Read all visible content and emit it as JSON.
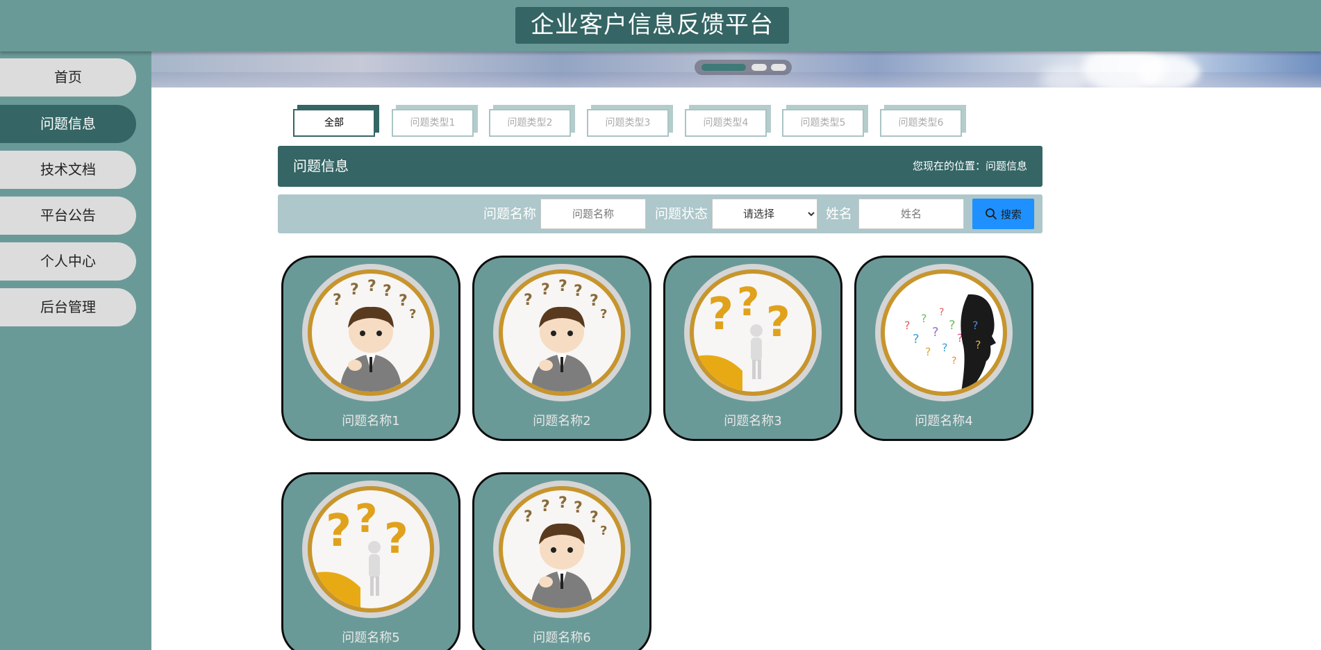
{
  "header": {
    "site_title": "企业客户信息反馈平台"
  },
  "sidebar": {
    "items": [
      {
        "label": "首页"
      },
      {
        "label": "问题信息"
      },
      {
        "label": "技术文档"
      },
      {
        "label": "平台公告"
      },
      {
        "label": "个人中心"
      },
      {
        "label": "后台管理"
      }
    ],
    "active_index": 1
  },
  "tabs": [
    {
      "label": "全部"
    },
    {
      "label": "问题类型1"
    },
    {
      "label": "问题类型2"
    },
    {
      "label": "问题类型3"
    },
    {
      "label": "问题类型4"
    },
    {
      "label": "问题类型5"
    },
    {
      "label": "问题类型6"
    }
  ],
  "section": {
    "title": "问题信息",
    "breadcrumb": "您现在的位置：问题信息"
  },
  "search": {
    "name_label": "问题名称",
    "name_placeholder": "问题名称",
    "status_label": "问题状态",
    "status_selected": "请选择",
    "person_label": "姓名",
    "person_placeholder": "姓名",
    "button_label": "搜索"
  },
  "cards": [
    {
      "name": "问题名称1",
      "image": "thinking-man"
    },
    {
      "name": "问题名称2",
      "image": "thinking-man"
    },
    {
      "name": "问题名称3",
      "image": "question-marks-figure"
    },
    {
      "name": "问题名称4",
      "image": "head-silhouette-questions"
    },
    {
      "name": "问题名称5",
      "image": "question-marks-figure"
    },
    {
      "name": "问题名称6",
      "image": "thinking-man"
    }
  ],
  "colors": {
    "primary": "#356565",
    "sidebar": "#6a9a98",
    "search_bar": "#adc7ca",
    "search_button": "#1e90ff",
    "ring": "#c8952c"
  }
}
